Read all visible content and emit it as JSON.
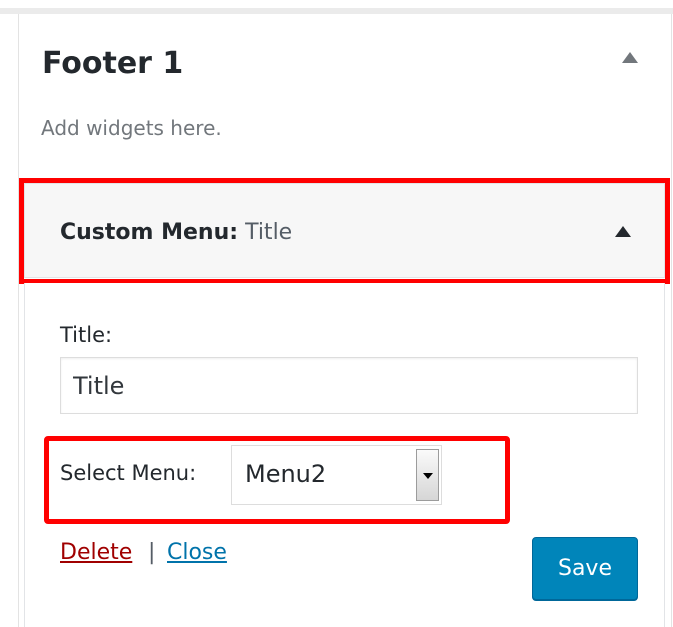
{
  "sidebar": {
    "title": "Footer 1",
    "description": "Add widgets here."
  },
  "widget": {
    "name": "Custom Menu:",
    "in_title": "Title",
    "title_field": {
      "label": "Title:",
      "value": "Title"
    },
    "menu_select": {
      "label": "Select Menu:",
      "value": "Menu2"
    },
    "actions": {
      "delete_label": "Delete",
      "separator": "|",
      "close_label": "Close",
      "save_label": "Save"
    }
  },
  "icons": {
    "sidebar_toggle": "arrow-up-icon",
    "widget_toggle": "arrow-up-icon",
    "select_dropdown": "chevron-down-icon"
  },
  "colors": {
    "highlight": "#ff0000",
    "primary_button": "#0085ba",
    "delete_link": "#a00000",
    "close_link": "#0073aa"
  }
}
